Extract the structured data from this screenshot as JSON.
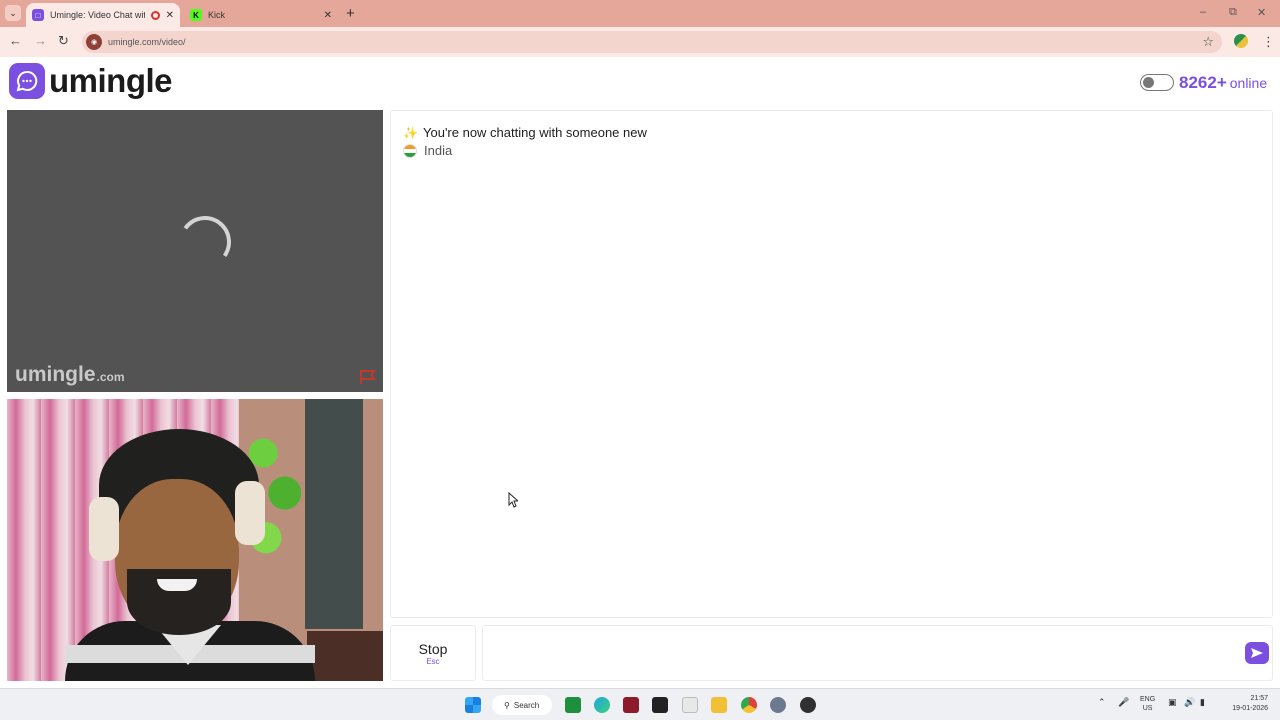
{
  "browser": {
    "tabs": [
      {
        "title": "Umingle: Video Chat with S",
        "active": true
      },
      {
        "title": "Kick",
        "active": false
      }
    ],
    "url": "umingle.com/video/"
  },
  "site": {
    "logo_text": "umingle",
    "online_count": "8262+",
    "online_label": "online",
    "brand_color": "#7b4fe0"
  },
  "stranger_video": {
    "watermark": "umingle",
    "watermark_suffix": ".com"
  },
  "chat": {
    "system_message": "You're now chatting with someone new",
    "country": "India"
  },
  "controls": {
    "stop_label": "Stop",
    "stop_key": "Esc",
    "message_value": ""
  },
  "taskbar": {
    "search_label": "Search",
    "lang": "ENG",
    "region": "US",
    "time": "21:57",
    "date": "19-01-2026"
  }
}
